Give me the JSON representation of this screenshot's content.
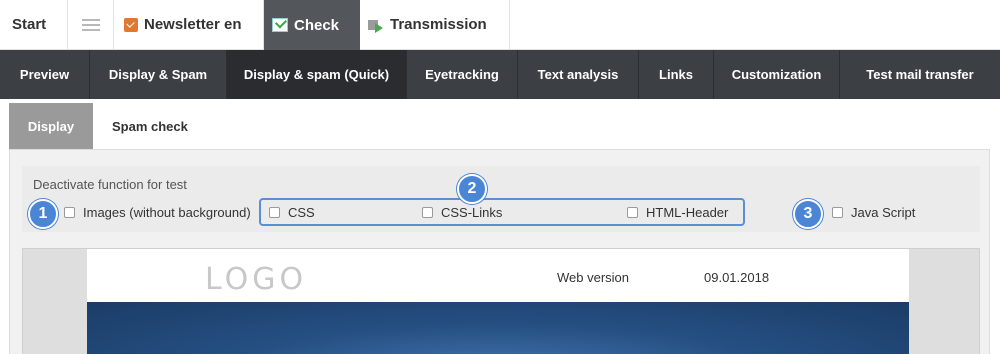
{
  "top_tabs": {
    "start": "Start",
    "newsletter": "Newsletter en",
    "check": "Check",
    "transmission": "Transmission"
  },
  "sub_nav": [
    {
      "label": "Preview",
      "active": false
    },
    {
      "label": "Display & Spam",
      "active": false
    },
    {
      "label": "Display & spam (Quick)",
      "active": true
    },
    {
      "label": "Eyetracking",
      "active": false
    },
    {
      "label": "Text analysis",
      "active": false
    },
    {
      "label": "Links",
      "active": false
    },
    {
      "label": "Customization",
      "active": false
    },
    {
      "label": "Test mail transfer",
      "active": false
    }
  ],
  "third_tabs": {
    "display": "Display",
    "spam_check": "Spam check"
  },
  "options": {
    "heading": "Deactivate function for test",
    "images": "Images (without background)",
    "css": "CSS",
    "css_links": "CSS-Links",
    "html_header": "HTML-Header",
    "javascript": "Java Script"
  },
  "markers": {
    "one": "1",
    "two": "2",
    "three": "3"
  },
  "preview": {
    "logo": "LOGO",
    "web_version": "Web version",
    "date": "09.01.2018"
  },
  "colors": {
    "active_top_tab": "#53565a",
    "sub_nav_bg": "#3c3f44",
    "marker_blue": "#4b86d6"
  }
}
